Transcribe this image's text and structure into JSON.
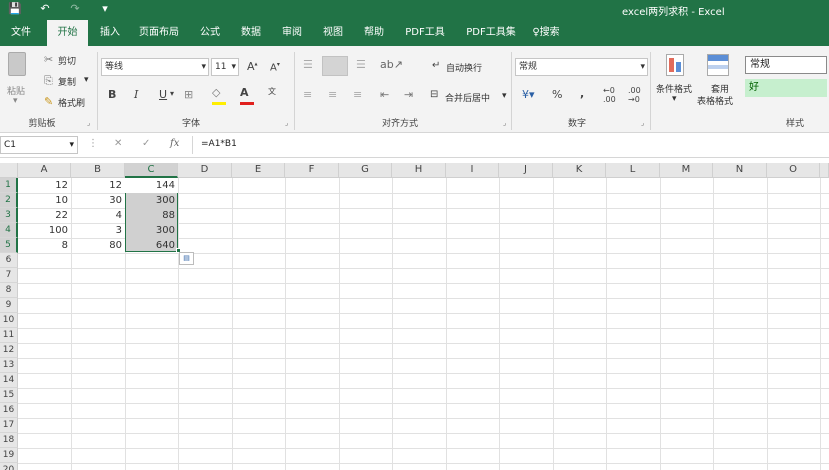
{
  "app": {
    "title": "excel两列求积 - Excel"
  },
  "qat": {
    "save_icon": "💾",
    "undo_icon": "↶",
    "redo_icon": "↷",
    "customize_icon": "▾"
  },
  "tabs": [
    {
      "label": "文件"
    },
    {
      "label": "开始"
    },
    {
      "label": "插入"
    },
    {
      "label": "页面布局"
    },
    {
      "label": "公式"
    },
    {
      "label": "数据"
    },
    {
      "label": "审阅"
    },
    {
      "label": "视图"
    },
    {
      "label": "帮助"
    },
    {
      "label": "PDF工具"
    },
    {
      "label": "PDF工具集"
    },
    {
      "label": "搜索"
    }
  ],
  "ribbon": {
    "clipboard": {
      "paste": "粘贴",
      "cut": "剪切",
      "copy": "复制",
      "format_painter": "格式刷",
      "label": "剪贴板"
    },
    "font": {
      "family": "等线",
      "size": "11",
      "grow": "A",
      "shrink": "A",
      "bold": "B",
      "italic": "I",
      "underline": "U",
      "label": "字体"
    },
    "alignment": {
      "wrap_text": "自动换行",
      "merge_center": "合并后居中",
      "label": "对齐方式"
    },
    "number": {
      "format": "常规",
      "percent": "%",
      "comma": ",",
      "label": "数字"
    },
    "styles": {
      "conditional": "条件格式",
      "table_format_1": "套用",
      "table_format_2": "表格格式",
      "normal": "常规",
      "good": "好",
      "label": "样式"
    }
  },
  "formula_bar": {
    "name_box": "C1",
    "cancel_icon": "✕",
    "enter_icon": "✓",
    "fx": "fx",
    "formula": "=A1*B1"
  },
  "sheet": {
    "columns": [
      "A",
      "B",
      "C",
      "D",
      "E",
      "F",
      "G",
      "H",
      "I",
      "J",
      "K",
      "L",
      "M",
      "N",
      "O"
    ],
    "rows": [
      "1",
      "2",
      "3",
      "4",
      "5",
      "6",
      "7",
      "8",
      "9",
      "10",
      "11",
      "12",
      "13",
      "14",
      "15",
      "16",
      "17",
      "18",
      "19",
      "20"
    ],
    "data": [
      {
        "a": "12",
        "b": "12",
        "c": "144"
      },
      {
        "a": "10",
        "b": "30",
        "c": "300"
      },
      {
        "a": "22",
        "b": "4",
        "c": "88"
      },
      {
        "a": "100",
        "b": "3",
        "c": "300"
      },
      {
        "a": "8",
        "b": "80",
        "c": "640"
      }
    ]
  }
}
